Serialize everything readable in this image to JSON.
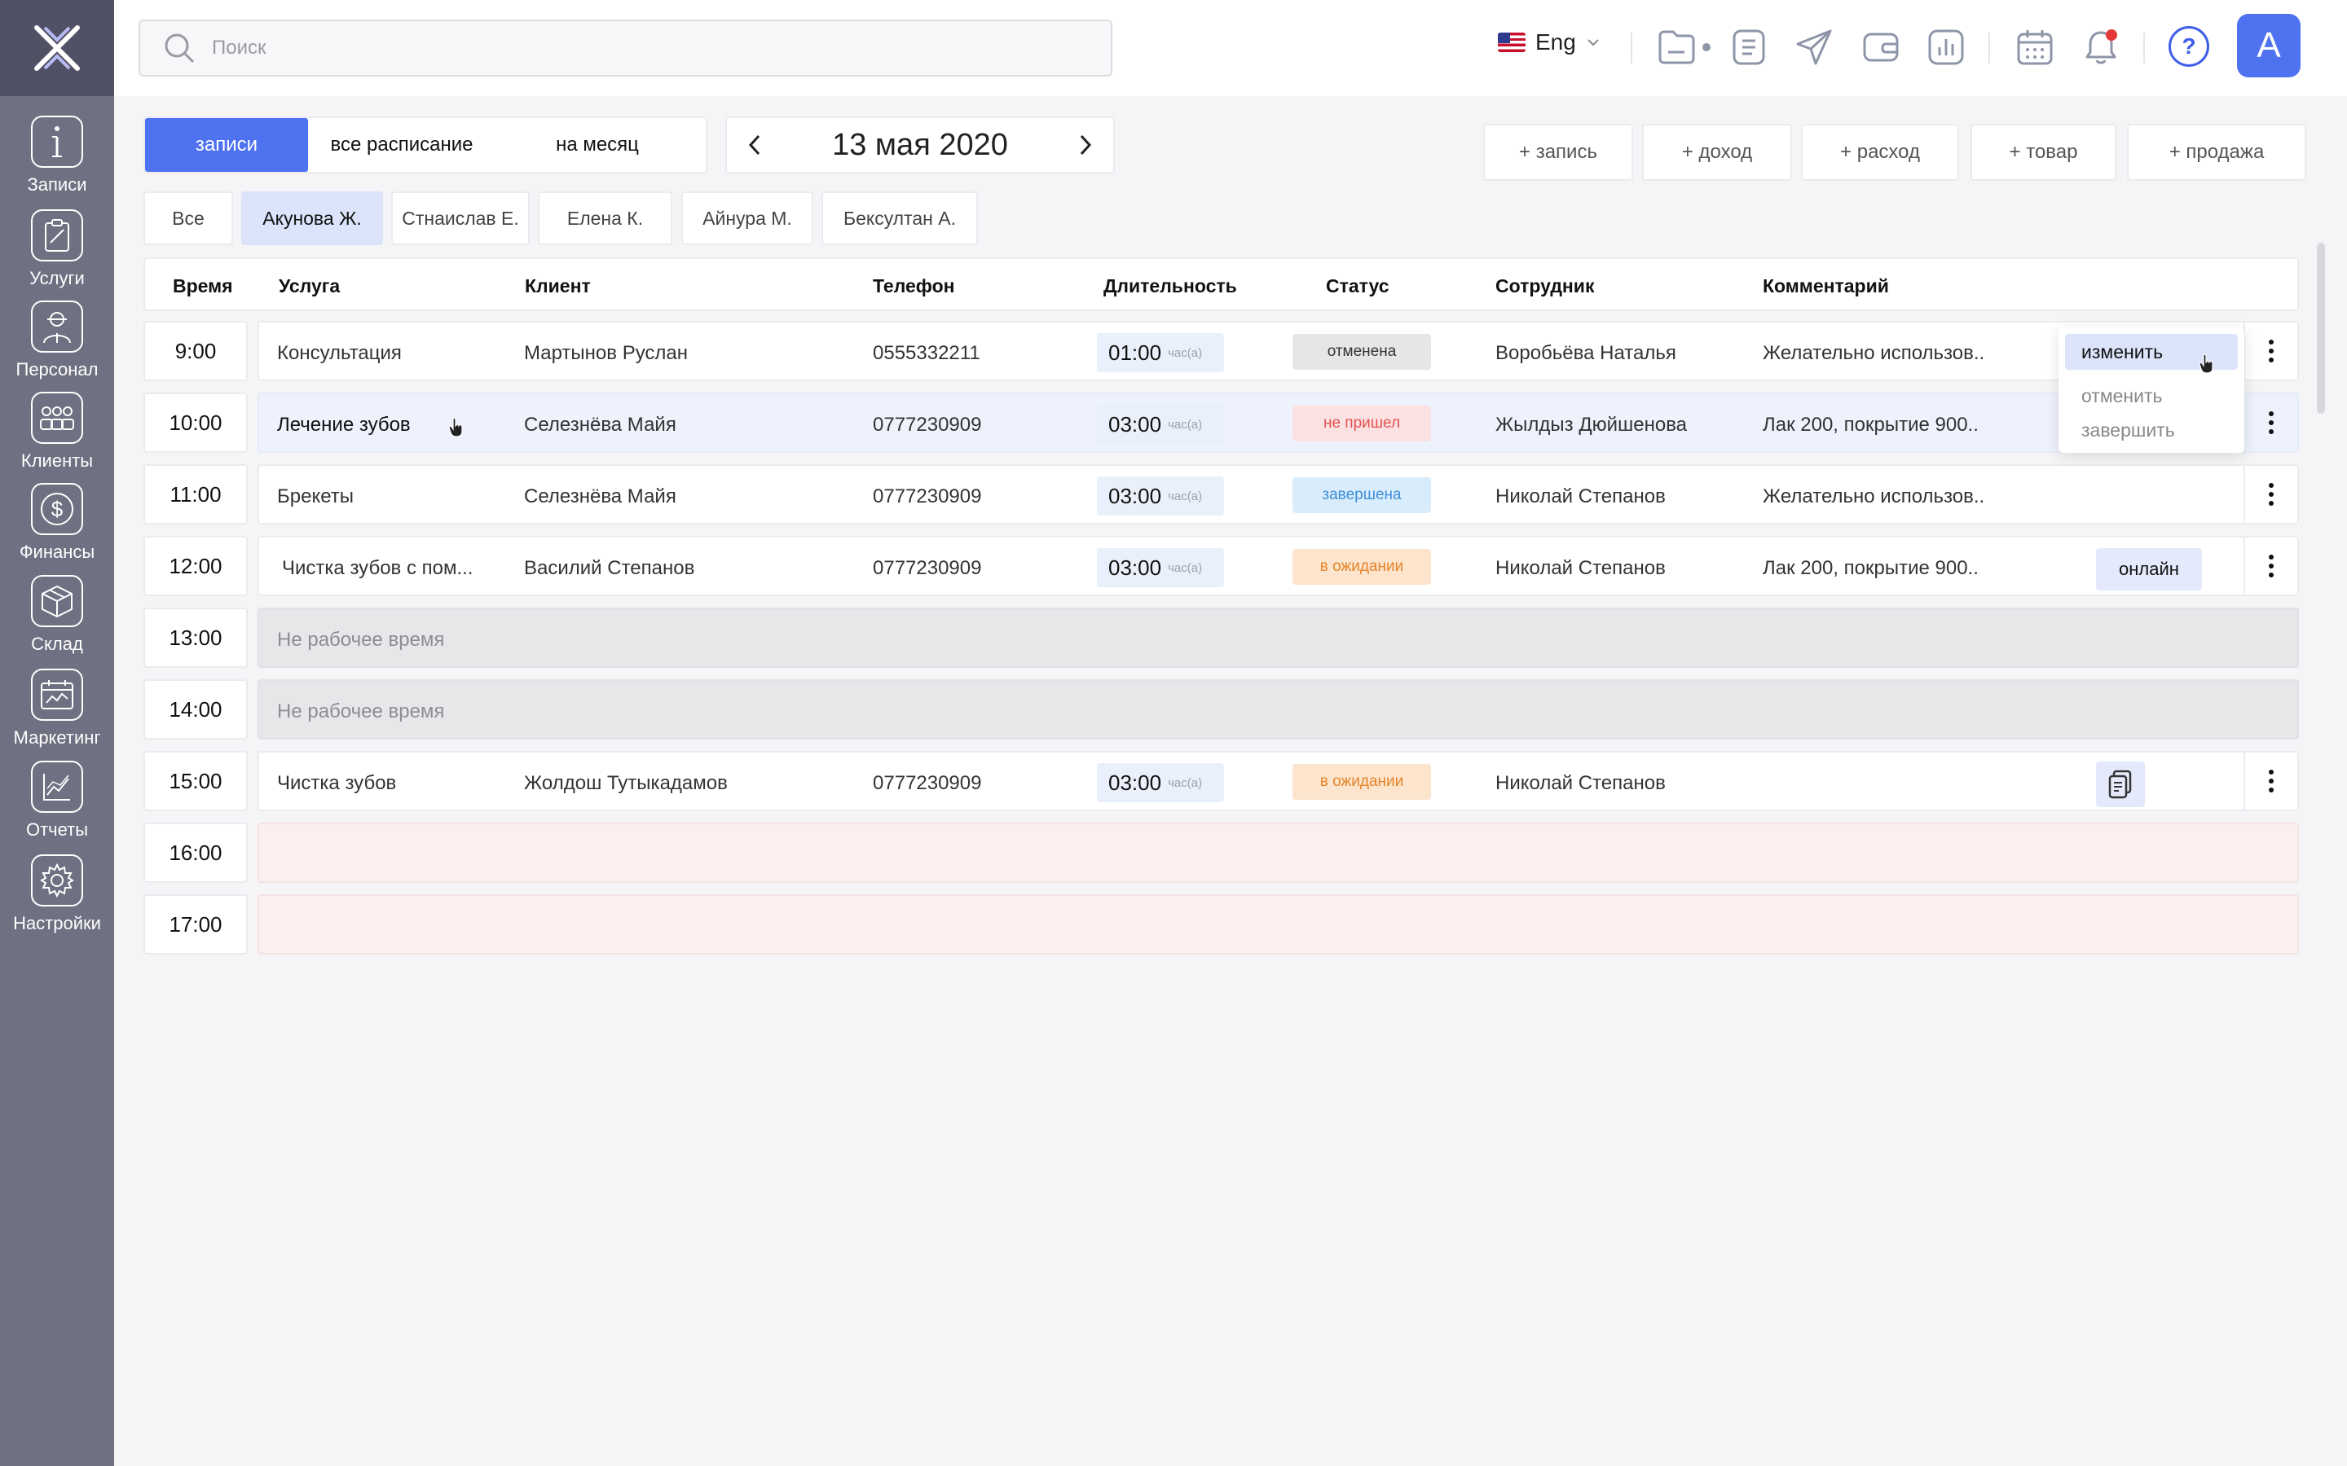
{
  "sidebar": {
    "items": [
      {
        "label": "Записи",
        "icon": "info-icon"
      },
      {
        "label": "Услуги",
        "icon": "clipboard-icon"
      },
      {
        "label": "Персонал",
        "icon": "staff-icon"
      },
      {
        "label": "Клиенты",
        "icon": "clients-icon"
      },
      {
        "label": "Финансы",
        "icon": "dollar-icon"
      },
      {
        "label": "Склад",
        "icon": "box-icon"
      },
      {
        "label": "Маркетинг",
        "icon": "marketing-icon"
      },
      {
        "label": "Отчеты",
        "icon": "chart-icon"
      },
      {
        "label": "Настройки",
        "icon": "gear-icon"
      }
    ]
  },
  "header": {
    "search_placeholder": "Поиск",
    "language": "Eng",
    "avatar_letter": "A",
    "help_symbol": "?"
  },
  "view_tabs": [
    {
      "label": "записи",
      "active": true
    },
    {
      "label": "все расписание",
      "active": false
    },
    {
      "label": "на месяц",
      "active": false
    }
  ],
  "date": "13 мая 2020",
  "actions": [
    "+ запись",
    "+ доход",
    "+ расход",
    "+ товар",
    "+ продажа"
  ],
  "staff_filter": [
    {
      "label": "Все",
      "active": false
    },
    {
      "label": "Акунова Ж.",
      "active": true
    },
    {
      "label": "Стнаислав Е.",
      "active": false
    },
    {
      "label": "Елена К.",
      "active": false
    },
    {
      "label": "Айнура М.",
      "active": false
    },
    {
      "label": "Бексултан А.",
      "active": false
    }
  ],
  "columns": [
    "Время",
    "Услуга",
    "Клиент",
    "Телефон",
    "Длительность",
    "Статус",
    "Сотрудник",
    "Комментарий"
  ],
  "rows": [
    {
      "time": "9:00",
      "service": "Консультация",
      "client": "Мартынов Руслан",
      "phone": "0555332211",
      "duration": "01:00",
      "unit": "час(а)",
      "status": "отменена",
      "employee": "Воробьёва Наталья",
      "comment": "Желательно использов.."
    },
    {
      "time": "10:00",
      "service": "Лечение зубов",
      "client": "Селезнёва Майя",
      "phone": "0777230909",
      "duration": "03:00",
      "unit": "час(а)",
      "status": "не пришел",
      "employee": "Жылдыз Дюйшенова",
      "comment": "Лак 200, покрытие 900.."
    },
    {
      "time": "11:00",
      "service": "Брекеты",
      "client": "Селезнёва Майя",
      "phone": "0777230909",
      "duration": "03:00",
      "unit": "час(а)",
      "status": "завершена",
      "employee": "Николай Степанов",
      "comment": "Желательно использов.."
    },
    {
      "time": "12:00",
      "service": "Чистка зубов с пом...",
      "client": "Василий Степанов",
      "phone": "0777230909",
      "duration": "03:00",
      "unit": "час(а)",
      "status": "в ожидании",
      "employee": "Николай Степанов",
      "comment": "Лак 200, покрытие 900..",
      "extra": "онлайн"
    },
    {
      "time": "13:00",
      "off": "Не рабочее время"
    },
    {
      "time": "14:00",
      "off": "Не рабочее время"
    },
    {
      "time": "15:00",
      "service": "Чистка зубов",
      "client": "Жолдош Тутыкадамов",
      "phone": "0777230909",
      "duration": "03:00",
      "unit": "час(а)",
      "status": "в ожидании",
      "employee": "Николай Степанов"
    },
    {
      "time": "16:00"
    },
    {
      "time": "17:00"
    }
  ],
  "row_menu": [
    "изменить",
    "отменить",
    "завершить"
  ],
  "colors": {
    "accent": "#4f73f0",
    "sidebar": "#6f7081",
    "status_cancelled": "#e6e6e9",
    "status_no_show": "#e35151",
    "status_done": "#3d8fd8",
    "status_waiting": "#e5852b"
  }
}
